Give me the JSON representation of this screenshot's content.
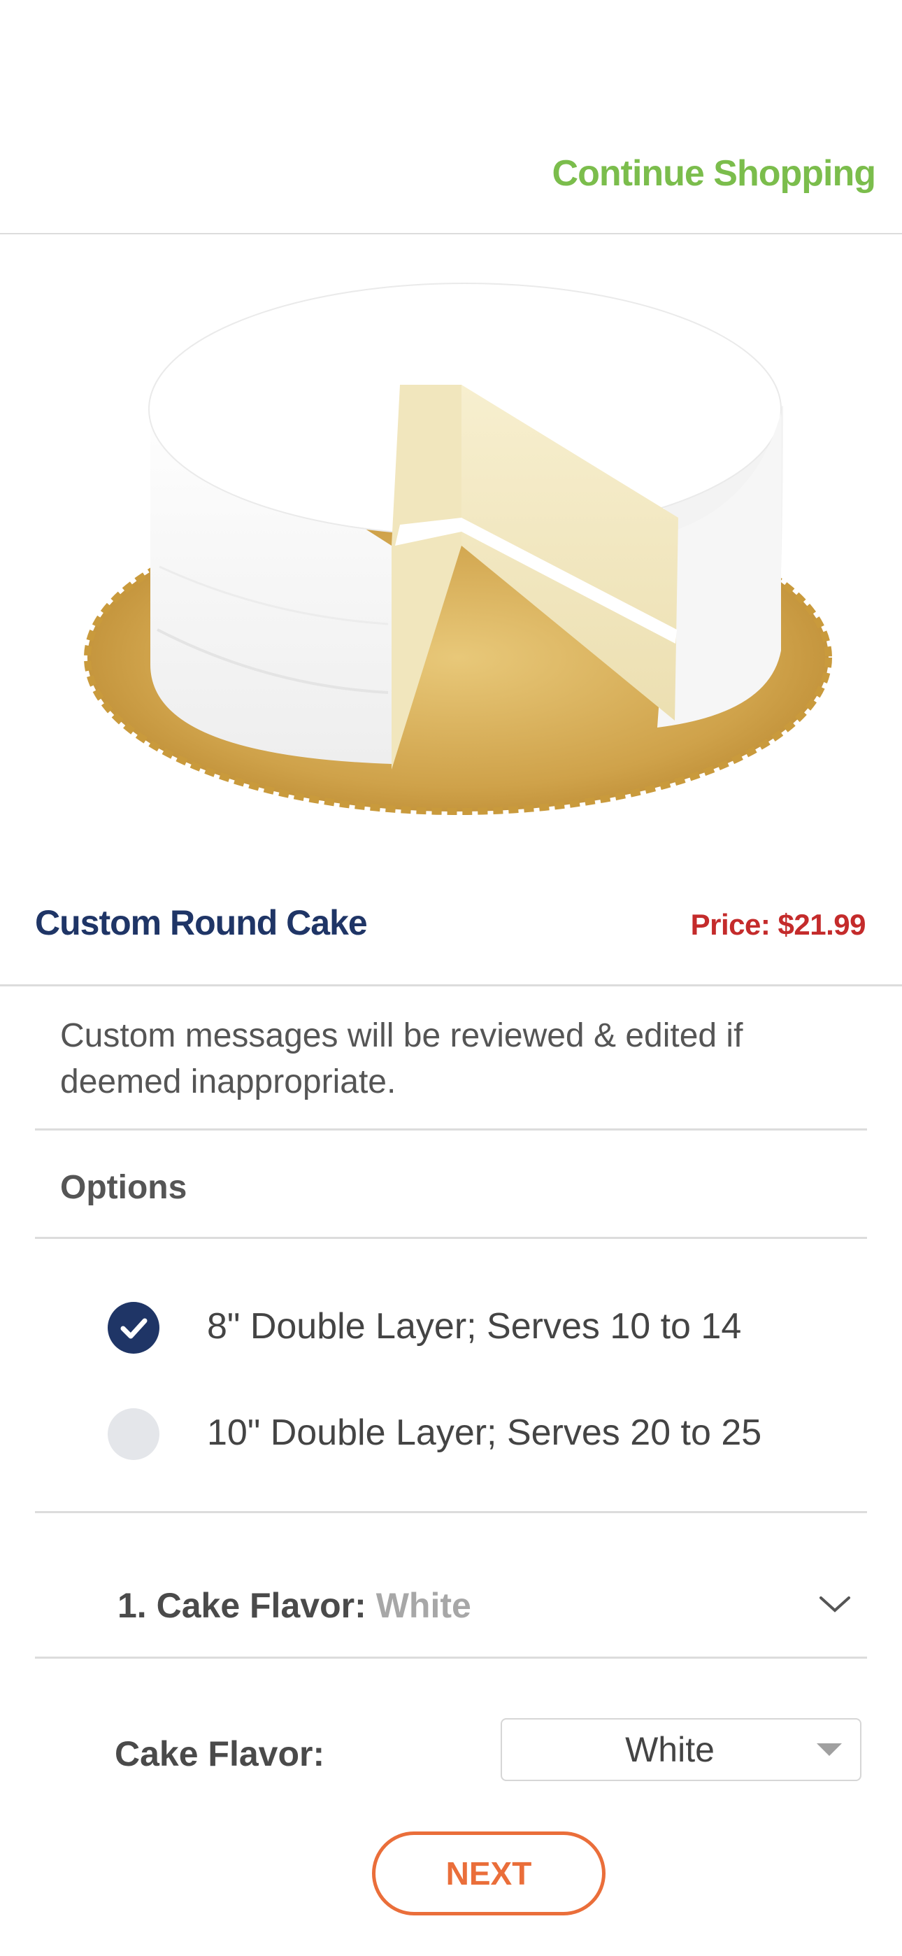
{
  "header": {
    "continue_label": "Continue Shopping"
  },
  "product": {
    "image_alt": "white round layer cake on gold board",
    "title": "Custom Round Cake",
    "price": "Price: $21.99",
    "notice": "Custom messages will be reviewed & edited if deemed inappropriate."
  },
  "options": {
    "heading": "Options",
    "items": [
      {
        "label": "8\" Double Layer; Serves 10 to 14",
        "checked": true
      },
      {
        "label": "10\" Double Layer; Serves 20 to 25",
        "checked": false
      }
    ]
  },
  "flavor_section": {
    "label": "1. Cake Flavor:",
    "value": "White",
    "field_label": "Cake Flavor:",
    "select_value": "White"
  },
  "next_label": "NEXT",
  "colors": {
    "brand_navy": "#1f3566",
    "link_green": "#7bbd4c",
    "price_red": "#c42b2b",
    "cta_orange": "#ea6e3a"
  }
}
